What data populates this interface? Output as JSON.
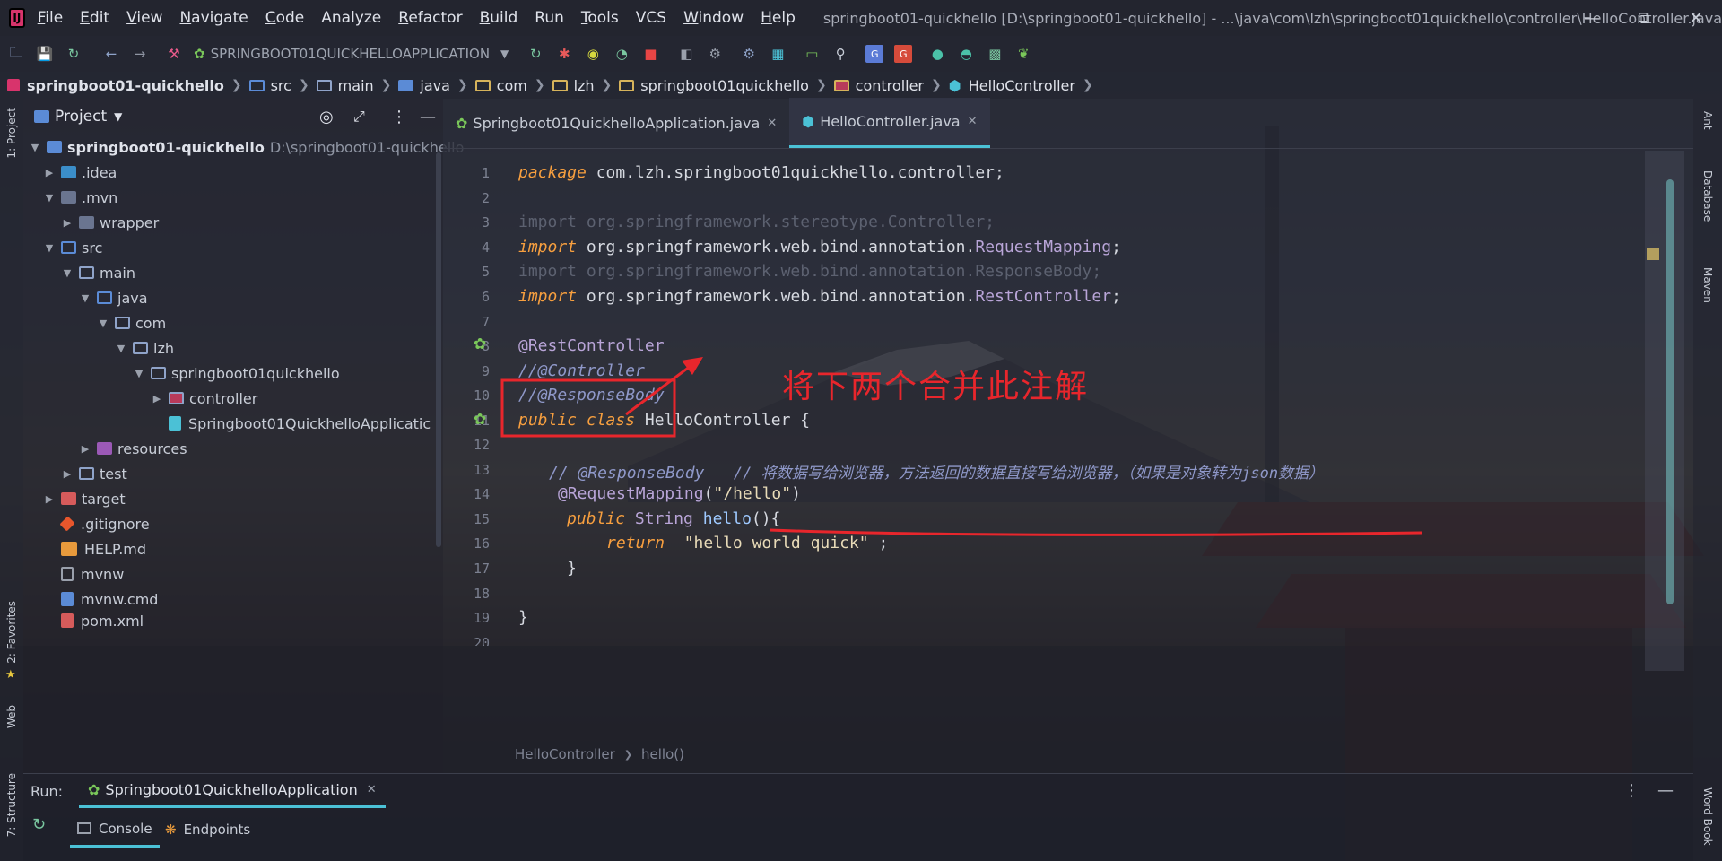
{
  "app": {
    "window_title": "springboot01-quickhello [D:\\springboot01-quickhello] - ...\\java\\com\\lzh\\springboot01quickhello\\controller\\HelloController.java",
    "accent": "#4bc1d6",
    "annotation_color": "#e8262c"
  },
  "menu": [
    {
      "mnemonic": "F",
      "rest": "ile"
    },
    {
      "mnemonic": "E",
      "rest": "dit"
    },
    {
      "mnemonic": "V",
      "rest": "iew"
    },
    {
      "mnemonic": "N",
      "rest": "avigate"
    },
    {
      "mnemonic": "C",
      "rest": "ode"
    },
    {
      "mnemonic": "",
      "rest": "Analyze"
    },
    {
      "mnemonic": "R",
      "rest": "efactor"
    },
    {
      "mnemonic": "B",
      "rest": "uild"
    },
    {
      "mnemonic": "",
      "rest": "Run"
    },
    {
      "mnemonic": "T",
      "rest": "ools"
    },
    {
      "mnemonic": "",
      "rest": "VCS"
    },
    {
      "mnemonic": "W",
      "rest": "indow"
    },
    {
      "mnemonic": "H",
      "rest": "elp"
    }
  ],
  "toolbar": {
    "run_config": "SPRINGBOOT01QUICKHELLOAPPLICATION"
  },
  "breadcrumb": [
    "springboot01-quickhello",
    "src",
    "main",
    "java",
    "com",
    "lzh",
    "springboot01quickhello",
    "controller",
    "HelloController"
  ],
  "project_panel": {
    "title": "Project",
    "root_name": "springboot01-quickhello",
    "root_path": "D:\\springboot01-quickhello",
    "items": [
      {
        "label": ".idea",
        "expanded": false,
        "kind": "folder-idea"
      },
      {
        "label": ".mvn",
        "expanded": true,
        "kind": "folder"
      },
      {
        "label": "wrapper",
        "expanded": false,
        "kind": "folder"
      },
      {
        "label": "src",
        "expanded": true,
        "kind": "folder-src"
      },
      {
        "label": "main",
        "expanded": true,
        "kind": "folder"
      },
      {
        "label": "java",
        "expanded": true,
        "kind": "folder"
      },
      {
        "label": "com",
        "expanded": true,
        "kind": "folder"
      },
      {
        "label": "lzh",
        "expanded": true,
        "kind": "folder"
      },
      {
        "label": "springboot01quickhello",
        "expanded": true,
        "kind": "folder"
      },
      {
        "label": "controller",
        "expanded": false,
        "kind": "folder-controller"
      },
      {
        "label": "Springboot01QuickhelloApplicatic",
        "expanded": null,
        "kind": "spring-class"
      },
      {
        "label": "resources",
        "expanded": false,
        "kind": "folder-resources"
      },
      {
        "label": "test",
        "expanded": false,
        "kind": "folder"
      },
      {
        "label": "target",
        "expanded": false,
        "kind": "folder-target"
      },
      {
        "label": ".gitignore",
        "expanded": null,
        "kind": "git"
      },
      {
        "label": "HELP.md",
        "expanded": null,
        "kind": "md"
      },
      {
        "label": "mvnw",
        "expanded": null,
        "kind": "file"
      },
      {
        "label": "mvnw.cmd",
        "expanded": null,
        "kind": "cmd"
      },
      {
        "label": "pom.xml",
        "expanded": null,
        "kind": "maven"
      }
    ]
  },
  "editor": {
    "tabs": [
      {
        "label": "Springboot01QuickhelloApplication.java",
        "active": false
      },
      {
        "label": "HelloController.java",
        "active": true
      }
    ],
    "line_numbers": [
      "1",
      "2",
      "3",
      "4",
      "5",
      "6",
      "7",
      "8",
      "9",
      "10",
      "11",
      "12",
      "13",
      "14",
      "15",
      "16",
      "17",
      "18",
      "19",
      "20"
    ],
    "code": {
      "l1_kw": "package",
      "l1_rest": " com.lzh.springboot01quickhello.controller;",
      "l3": "import org.springframework.stereotype.Controller;",
      "l4_kw": "import",
      "l4_mid": " org.springframework.web.bind.annotation.",
      "l4_cls": "RequestMapping",
      "l4_end": ";",
      "l5": "import org.springframework.web.bind.annotation.ResponseBody;",
      "l6_kw": "import",
      "l6_mid": " org.springframework.web.bind.annotation.",
      "l6_cls": "RestController",
      "l6_end": ";",
      "l8": "@RestController",
      "l9": "//@Controller",
      "l10": "//@ResponseBody",
      "l11_kw": "public class",
      "l11_rest": " HelloController {",
      "l13_a": "// @ResponseBody",
      "l13_b": "// 将数据写给浏览器，方法返回的数据直接写给浏览器，（如果是对象转为json数据）",
      "l14_an": "@RequestMapping",
      "l14_open": "(",
      "l14_str": "\"/hello\"",
      "l14_close": ")",
      "l15_kw": "public",
      "l15_type": " String ",
      "l15_fn": "hello",
      "l15_end": "(){",
      "l16_kw": "return",
      "l16_str": "  \"hello world quick\"",
      "l16_end": " ;",
      "l17": "}",
      "l19": "}"
    },
    "structure_crumb": [
      "HelloController",
      "hello()"
    ]
  },
  "annotation": {
    "text": "将下两个合并此注解"
  },
  "run_panel": {
    "label": "Run:",
    "config": "Springboot01QuickhelloApplication",
    "tabs": [
      "Console",
      "Endpoints"
    ]
  },
  "side_tools": {
    "left_top": "1: Project",
    "left_fav": "2: Favorites",
    "left_web": "Web",
    "left_struct": "7: Structure",
    "right": [
      "Ant",
      "Database",
      "Maven",
      "Word Book"
    ]
  }
}
